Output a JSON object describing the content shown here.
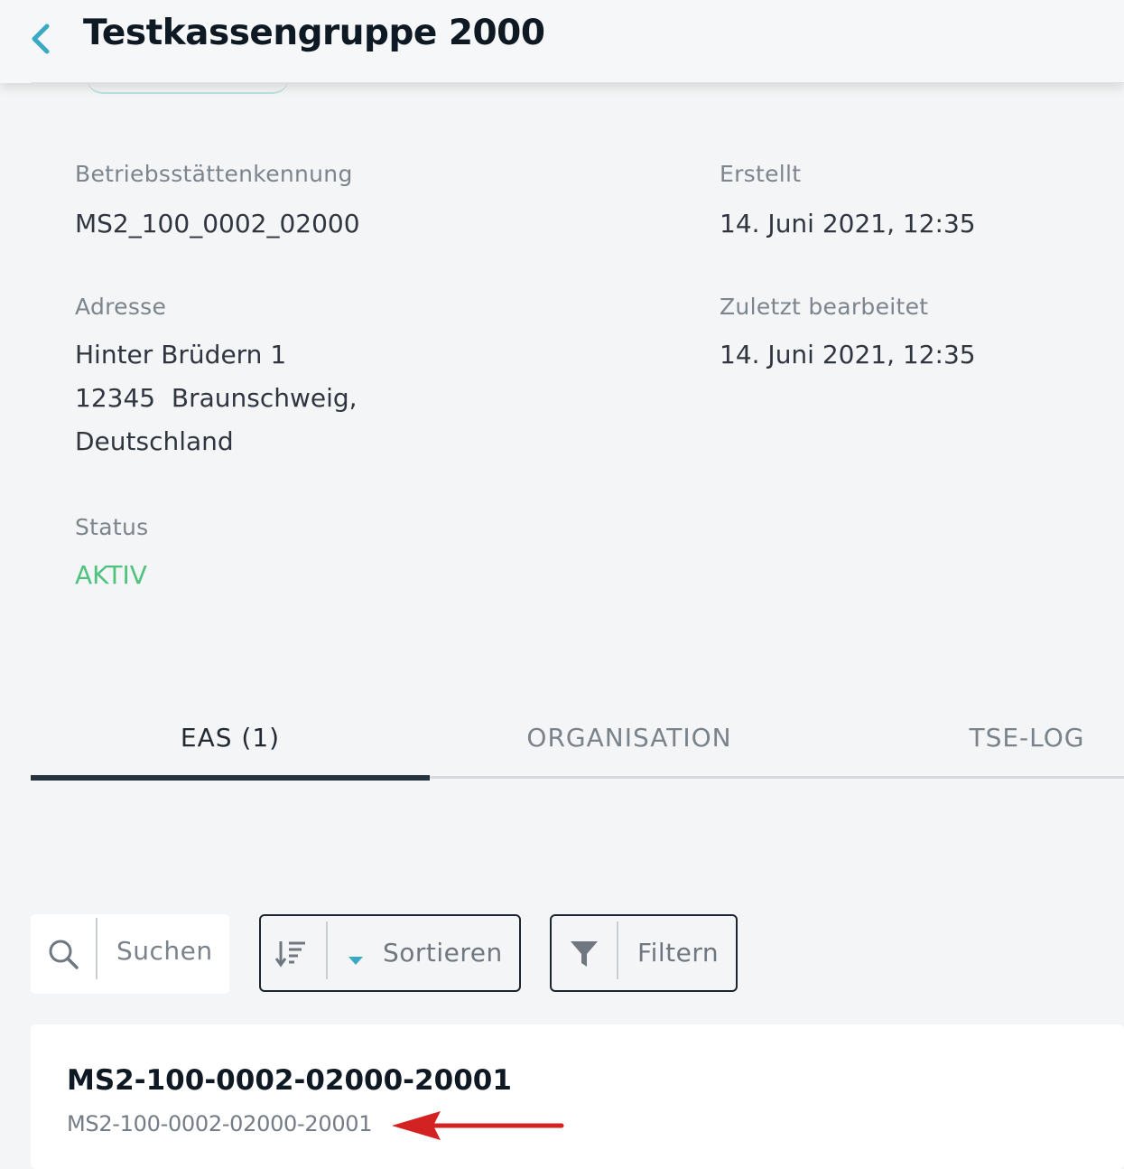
{
  "header": {
    "title": "Testkassengruppe 2000",
    "back_icon": "chevron-left-icon",
    "back_color": "#3aa9c4"
  },
  "details": {
    "betriebsstaette": {
      "label": "Betriebsstättenkennung",
      "value": "MS2_100_0002_02000"
    },
    "erstellt": {
      "label": "Erstellt",
      "value": "14. Juni 2021, 12:35"
    },
    "adresse": {
      "label": "Adresse",
      "lines": [
        "Hinter Brüdern 1",
        "12345  Braunschweig,",
        "Deutschland"
      ]
    },
    "zuletzt": {
      "label": "Zuletzt bearbeitet",
      "value": "14. Juni 2021, 12:35"
    },
    "status": {
      "label": "Status",
      "value": "AKTIV",
      "color": "#4fc27e"
    }
  },
  "tabs": [
    {
      "label": "EAS (1)",
      "active": true
    },
    {
      "label": "ORGANISATION",
      "active": false
    },
    {
      "label": "TSE-LOG",
      "active": false
    }
  ],
  "toolbar": {
    "search": {
      "placeholder": "Suchen",
      "icon": "search-icon"
    },
    "sort": {
      "label": "Sortieren",
      "icon": "sort-icon",
      "dropdown_icon": "caret-down-icon"
    },
    "filter": {
      "label": "Filtern",
      "icon": "filter-icon"
    }
  },
  "list": {
    "items": [
      {
        "title": "MS2-100-0002-02000-20001",
        "subtitle": "MS2-100-0002-02000-20001"
      }
    ]
  },
  "annotation": {
    "icon": "red-arrow-icon",
    "color": "#d32222"
  }
}
